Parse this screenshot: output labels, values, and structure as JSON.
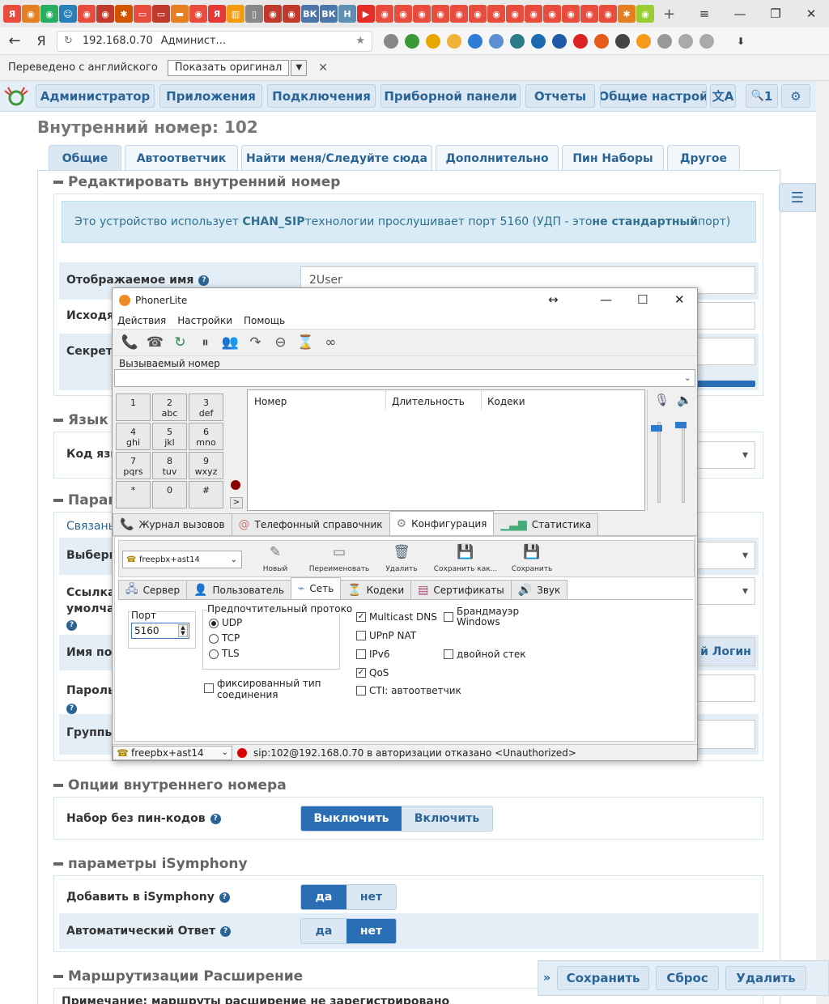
{
  "browser": {
    "tab_favicons": [
      "Я",
      "◉",
      "◉",
      "☺",
      "◉",
      "◉",
      "✱",
      "▭",
      "▭",
      "▬",
      "◉",
      "Я",
      "▥",
      "▯",
      "◉",
      "◉",
      "ВК",
      "ВК",
      "Н",
      "▶",
      "◉",
      "◉",
      "◉",
      "◉",
      "◉",
      "◉",
      "◉",
      "◉",
      "◉",
      "◉",
      "◉",
      "◉",
      "◉",
      "✱",
      "◉"
    ],
    "new_tab": "+",
    "menu": "≡",
    "min": "—",
    "restore": "❐",
    "close": "✕",
    "back": "←",
    "ya": "Я",
    "reload": "↻",
    "url": "192.168.0.70",
    "page_title": "Админист...",
    "translate_text": "Переведено с английского",
    "show_original": "Показать оригинал",
    "download": "⬇"
  },
  "nav": {
    "items": [
      "Администратор",
      "Приложения",
      "Подключения",
      "Приборной панели",
      "Отчеты",
      "Общие настрой"
    ],
    "lang_icon": "文A",
    "search_icon": "🔍",
    "search_suffix": "1",
    "gear_icon": "⚙"
  },
  "page": {
    "title": "Внутренний номер: 102",
    "tabs": [
      "Общие",
      "Автоответчик",
      "Найти меня/Следуйте сюда",
      "Дополнительно",
      "Пин Наборы",
      "Другое"
    ],
    "section_edit": "Редактировать внутренний номер",
    "info_prefix": "Это устройство использует ",
    "info_tech": "CHAN_SIP",
    "info_mid": " технологии прослушивает порт 5160 (УДП - это ",
    "info_bold": "не стандартный",
    "info_suffix": " порт)",
    "display_name_label": "Отображаемое имя",
    "display_name_value": "2User",
    "outgoing_label": "Исходя",
    "secret_label": "Секрет",
    "section_lang": "Язык",
    "lang_code_label": "Код язы",
    "section_params": "Парам",
    "linked_label": "Связаны",
    "select_label": "Выбери",
    "link_label_1": "Ссылка",
    "link_label_2": "умолча",
    "user_name_label": "Имя пол",
    "login_button": "й Логин",
    "password_label": "Пароль",
    "groups_label": "Группы",
    "section_options": "Опции внутреннего номера",
    "pin_dial_label": "Набор без пин-кодов",
    "off_label": "Выключить",
    "on_label": "Включить",
    "section_isym": "параметры iSymphony",
    "add_isym_label": "Добавить в iSymphony",
    "yes": "да",
    "no": "нет",
    "auto_answer_label": "Автоматический Ответ",
    "section_routing": "Маршрутизации Расширение",
    "routing_note": "Примечание: маршруты расширение не зарегистрировано",
    "save": "Сохранить",
    "reset": "Сброс",
    "delete": "Удалить",
    "footer_arrow": "»"
  },
  "phoner": {
    "title": "PhonerLite",
    "menu": [
      "Действия",
      "Настройки",
      "Помощь"
    ],
    "toolbar_icons": [
      "📞",
      "☎",
      "↻",
      "⏸",
      "👥",
      "↷",
      "⊖",
      "⌛",
      "∞"
    ],
    "called_number_label": "Вызываемый номер",
    "keys": [
      {
        "d": "1",
        "l": ""
      },
      {
        "d": "2",
        "l": "abc"
      },
      {
        "d": "3",
        "l": "def"
      },
      {
        "d": "4",
        "l": "ghi"
      },
      {
        "d": "5",
        "l": "jkl"
      },
      {
        "d": "6",
        "l": "mno"
      },
      {
        "d": "7",
        "l": "pqrs"
      },
      {
        "d": "8",
        "l": "tuv"
      },
      {
        "d": "9",
        "l": "wxyz"
      },
      {
        "d": "*",
        "l": ""
      },
      {
        "d": "0",
        "l": ""
      },
      {
        "d": "#",
        "l": ""
      }
    ],
    "more_btn": ">",
    "col_number": "Номер",
    "col_duration": "Длительность",
    "col_codecs": "Кодеки",
    "tabs": [
      "Журнал вызовов",
      "Телефонный справочник",
      "Конфигурация",
      "Статистика"
    ],
    "profile": "freepbx+ast14",
    "tb_new": "Новый",
    "tb_rename": "Переименовать",
    "tb_delete": "Удалить",
    "tb_save_as": "Сохранить как...",
    "tb_save": "Сохранить",
    "subtabs": [
      "Сервер",
      "Пользователь",
      "Сеть",
      "Кодеки",
      "Сертификаты",
      "Звук"
    ],
    "port_label": "Порт",
    "port_value": "5160",
    "proto_label": "Предпочтительный протоко",
    "proto_udp": "UDP",
    "proto_tcp": "TCP",
    "proto_tls": "TLS",
    "fixed_conn": "фиксированный тип",
    "fixed_conn2": "соединения",
    "multicast": "Multicast DNS",
    "upnp": "UPnP NAT",
    "ipv6": "IPv6",
    "qos": "QoS",
    "cti": "CTI: автоответчик",
    "firewall": "Брандмауэр",
    "firewall2": "Windows",
    "dual_stack": "двойной стек",
    "check_mark": "✓",
    "status_profile": "freepbx+ast14",
    "status_msg": "sip:102@192.168.0.70 в авторизации отказано <Unauthorized>"
  }
}
